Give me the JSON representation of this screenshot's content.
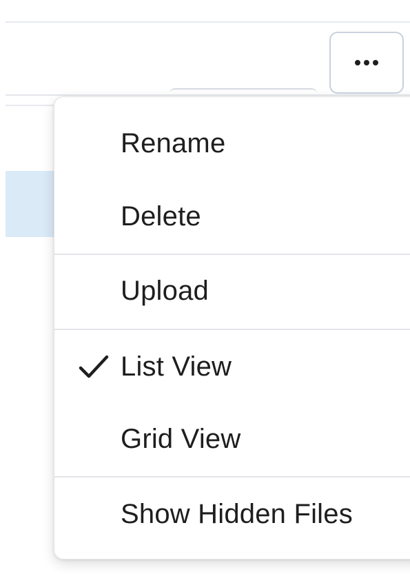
{
  "toolbar": {
    "more_button_icon": "more-horizontal-icon"
  },
  "menu": {
    "items": [
      {
        "label": "Rename",
        "checked": false
      },
      {
        "label": "Delete",
        "checked": false
      },
      {
        "label": "Upload",
        "checked": false
      },
      {
        "label": "List View",
        "checked": true
      },
      {
        "label": "Grid View",
        "checked": false
      },
      {
        "label": "Show Hidden Files",
        "checked": false
      }
    ],
    "check_icon": "checkmark-icon"
  },
  "colors": {
    "selected_row": "#dbeaf7",
    "menu_text": "#1e1e1e",
    "divider": "#e3e5e9",
    "button_border": "#c9d1dc"
  }
}
